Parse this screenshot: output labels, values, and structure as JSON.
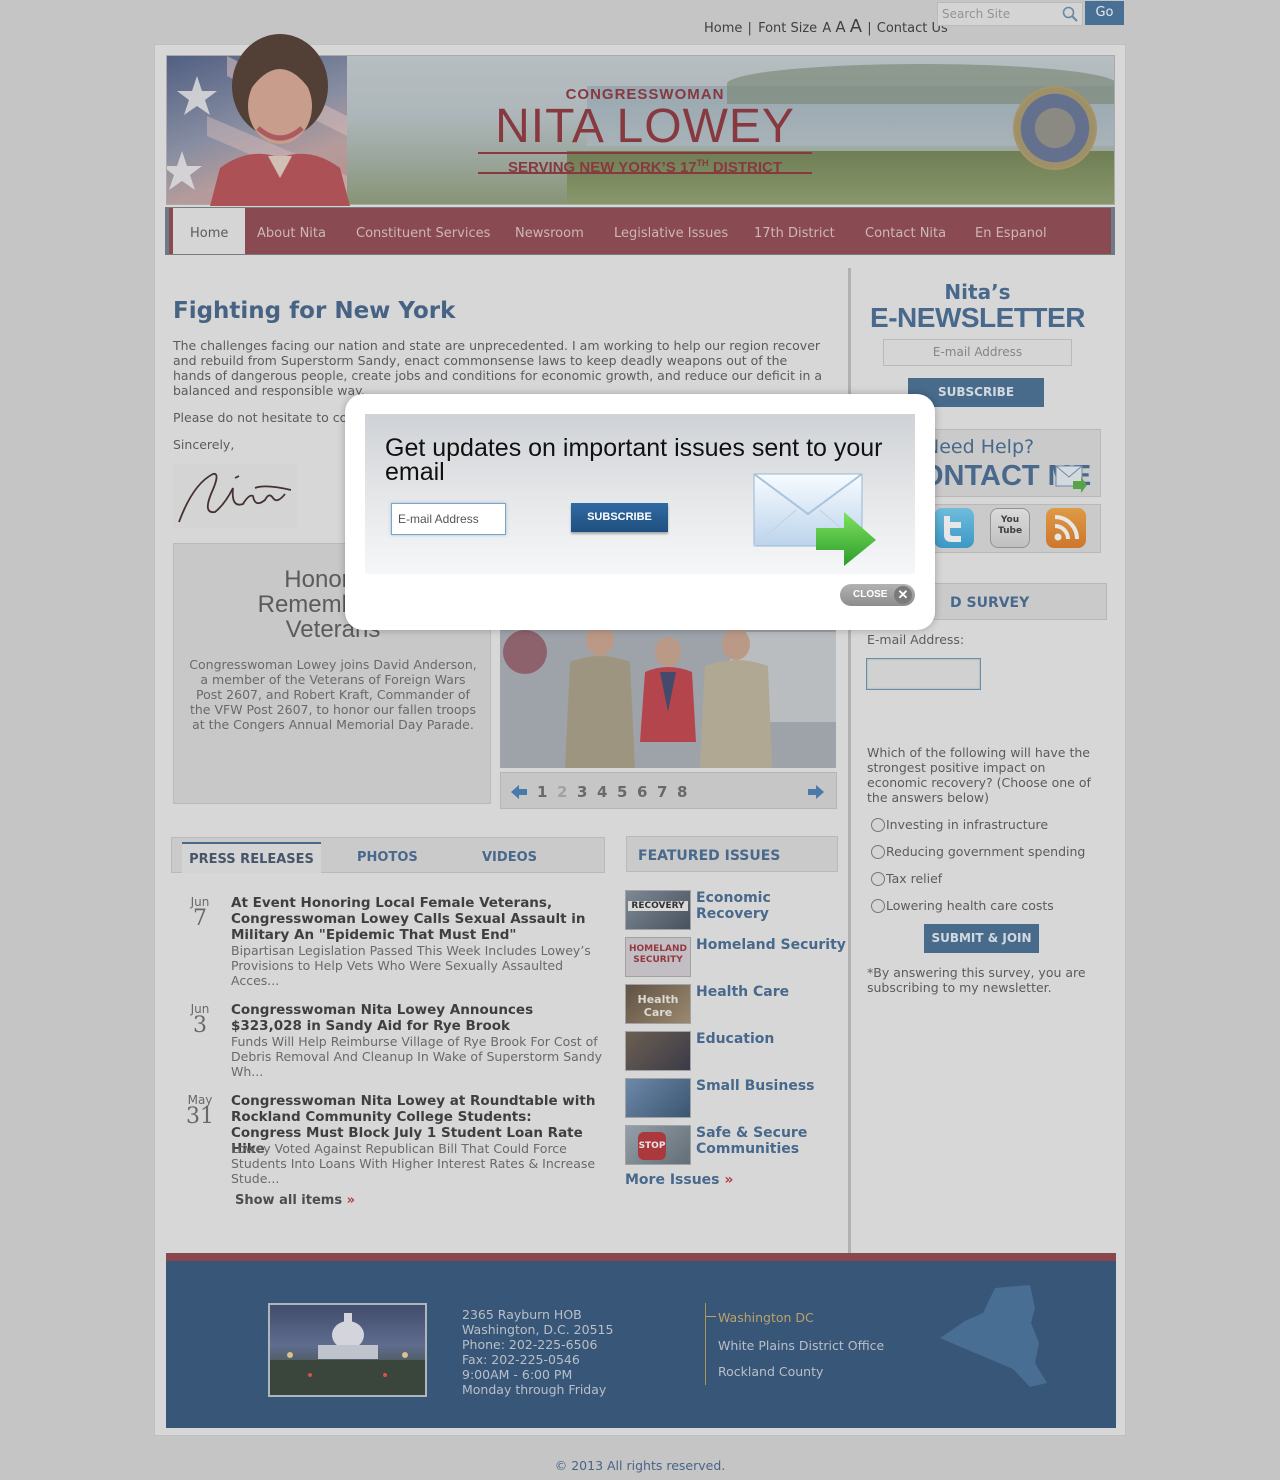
{
  "util": {
    "home": "Home",
    "sep": "|",
    "font_size": "Font Size",
    "a_small": "A",
    "a_medium": "A",
    "a_large": "A",
    "contact": "Contact Us",
    "search_placeholder": "Search Site",
    "go": "Go"
  },
  "banner": {
    "line1": "CONGRESSWOMAN",
    "line2": "NITA LOWEY",
    "line3": "SERVING NEW YORK’S 17",
    "line3_sup": "TH",
    "line3_end": " DISTRICT"
  },
  "nav": {
    "items": [
      "Home",
      "About Nita",
      "Constituent Services",
      "Newsroom",
      "Legislative Issues",
      "17th District",
      "Contact Nita",
      "En Espanol"
    ]
  },
  "main": {
    "title": "Fighting for New York",
    "para1": "The challenges facing our nation and state are unprecedented.  I am working to help our region recover and rebuild from Superstorm Sandy, enact commonsense laws to keep deadly weapons out of the hands of dangerous people, create jobs and conditions for economic growth, and reduce our deficit in a balanced and responsible way.",
    "para2": "Please do not hesitate to con",
    "sincerely": "Sincerely,"
  },
  "slideshow": {
    "heading": "Honoring\nRemembering\nVeterans",
    "caption": "Congresswoman Lowey joins David Anderson, a member of the Veterans of Foreign Wars Post 2607, and Robert Kraft, Commander of the VFW Post 2607, to honor our fallen troops at the Congers Annual Memorial Day Parade.",
    "pages": [
      "1",
      "2",
      "3",
      "4",
      "5",
      "6",
      "7",
      "8"
    ],
    "current_page": 2
  },
  "tabs": [
    "PRESS RELEASES",
    "PHOTOS",
    "VIDEOS"
  ],
  "press": [
    {
      "month": "Jun",
      "day": "7",
      "title": "At Event Honoring Local Female Veterans, Congresswoman Lowey Calls Sexual Assault in Military An \"Epidemic That Must End\"",
      "summary": "Bipartisan Legislation Passed This Week Includes Lowey’s Provisions to Help Vets Who Were Sexually Assaulted Acces..."
    },
    {
      "month": "Jun",
      "day": "3",
      "title": "Congresswoman Nita Lowey Announces $323,028 in Sandy Aid for Rye Brook",
      "summary": "Funds Will Help Reimburse Village of Rye Brook For Cost of Debris Removal And Cleanup In Wake of Superstorm Sandy Wh..."
    },
    {
      "month": "May",
      "day": "31",
      "title": "Congresswoman Nita Lowey at Roundtable with Rockland Community College Students: Congress Must Block July 1 Student Loan Rate Hike",
      "summary": "Lowey Voted Against Republican Bill That Could Force Students Into Loans With Higher Interest Rates & Increase Stude..."
    }
  ],
  "show_all": "Show all items",
  "featured": {
    "heading": "FEATURED ISSUES",
    "items": [
      {
        "label": "Economic Recovery",
        "thumb_text": "RECOVERY"
      },
      {
        "label": "Homeland Security",
        "thumb_text": "HOMELAND SECURITY"
      },
      {
        "label": "Health Care",
        "thumb_text": "Health Care"
      },
      {
        "label": "Education",
        "thumb_text": ""
      },
      {
        "label": "Small Business",
        "thumb_text": ""
      },
      {
        "label": "Safe & Secure Communities",
        "thumb_text": "STOP"
      }
    ],
    "more": "More Issues"
  },
  "sidebar": {
    "enews1": "Nita’s",
    "enews2": "E-NEWSLETTER",
    "email_placeholder": "E-mail Address",
    "subscribe": "SUBSCRIBE",
    "help1": "Need Help?",
    "help2": "CONTACT ME",
    "social": [
      "facebook-icon",
      "twitter-icon",
      "youtube-icon",
      "rss-icon"
    ],
    "youtube_text": "You Tube",
    "survey_title": "D SURVEY",
    "email_label": "E-mail Address:",
    "question": "Which of the following will have the strongest positive impact on economic recovery? (Choose one of the answers below)",
    "options": [
      "Investing in infrastructure",
      "Reducing government spending",
      "Tax relief",
      "Lowering health care costs"
    ],
    "submit": "SUBMIT & JOIN",
    "note": "*By answering this survey, you are subscribing to my newsletter."
  },
  "footer": {
    "address": [
      "2365 Rayburn HOB",
      "Washington, D.C. 20515",
      "Phone: 202-225-6506",
      "Fax: 202-225-0546",
      "9:00AM - 6:00 PM",
      "Monday through Friday"
    ],
    "offices": [
      "Washington DC",
      "White Plains District Office",
      "Rockland County"
    ],
    "copyright": "© 2013 All rights reserved."
  },
  "modal": {
    "title": "Get updates on important issues sent to your email",
    "email_placeholder": "E-mail Address",
    "subscribe": "SUBSCRIBE",
    "close": "CLOSE",
    "close_x": "✕"
  },
  "colors": {
    "accent_blue": "#3d6691",
    "nav_red": "#8e4048",
    "footer_blue": "#2a4f77"
  }
}
